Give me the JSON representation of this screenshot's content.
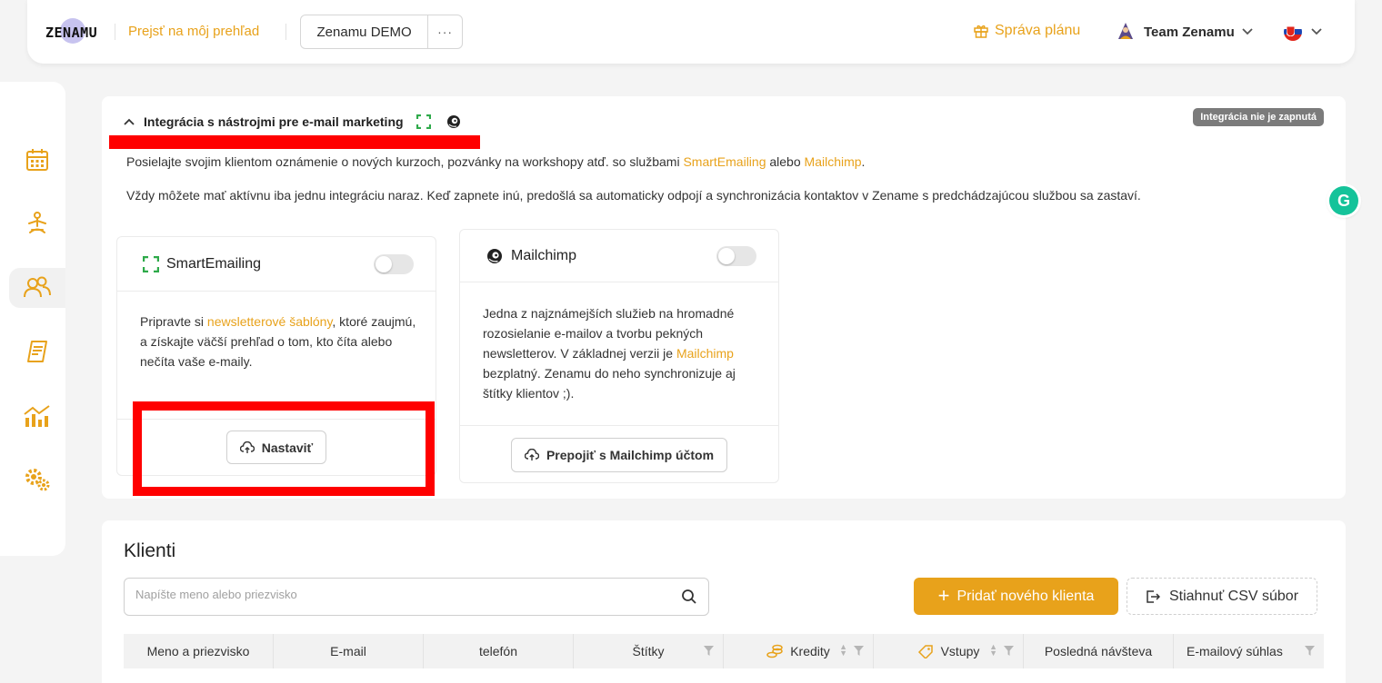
{
  "header": {
    "logo_text": "ZENAMU",
    "go_link": "Prejsť na môj prehľad",
    "demo_label": "Zenamu DEMO",
    "more_label": "···",
    "plan_label": "Správa plánu",
    "team_label": "Team Zenamu"
  },
  "sidebar": {
    "items": [
      "calendar-icon",
      "yoga-icon",
      "clients-icon",
      "invoice-icon",
      "stats-icon",
      "settings-icon"
    ],
    "active": "clients-icon"
  },
  "integration": {
    "title": "Integrácia s nástrojmi pre e-mail marketing",
    "status_badge": "Integrácia nie je zapnutá",
    "desc_before": "Posielajte svojim klientom oznámenie o nových kurzoch, pozvánky na workshopy atď. so službami ",
    "desc_link1": "SmartEmailing",
    "desc_middle": " alebo ",
    "desc_link2": "Mailchimp",
    "desc_after": ".",
    "desc2": "Vždy môžete mať aktívnu iba jednu integráciu naraz. Keď zapnete inú, predošlá sa automaticky odpojí a synchronizácia kontaktov v Zename s predchádzajúcou službou sa zastaví.",
    "smart": {
      "title": "SmartEmailing",
      "body_before": "Pripravte si ",
      "body_link": "newsletterové šablóny",
      "body_after": ", ktoré zaujmú, a získajte väčší prehľad o tom, kto číta alebo nečíta vaše e-maily.",
      "button": "Nastaviť",
      "enabled": false
    },
    "mailchimp": {
      "title": "Mailchimp",
      "body_before": "Jedna z najznámejších služieb na hromadné rozosielanie e-mailov a tvorbu pekných newsletterov. V základnej verzii je ",
      "body_link": "Mailchimp",
      "body_after": " bezplatný. Zenamu do neho synchronizuje aj štítky klientov ;).",
      "button": "Prepojiť s Mailchimp účtom",
      "enabled": false
    }
  },
  "clients": {
    "title": "Klienti",
    "search_placeholder": "Napíšte meno alebo priezvisko",
    "add_button": "Pridať nového klienta",
    "csv_button": "Stiahnuť CSV súbor",
    "columns": [
      "Meno a priezvisko",
      "E-mail",
      "telefón",
      "Štítky",
      "Kredity",
      "Vstupy",
      "Posledná návšteva",
      "E-mailový súhlas"
    ]
  },
  "colors": {
    "accent": "#e8a21b",
    "highlight": "#ff0000",
    "smartemailing_green": "#2eaa4a",
    "grammarly": "#15c39a"
  }
}
